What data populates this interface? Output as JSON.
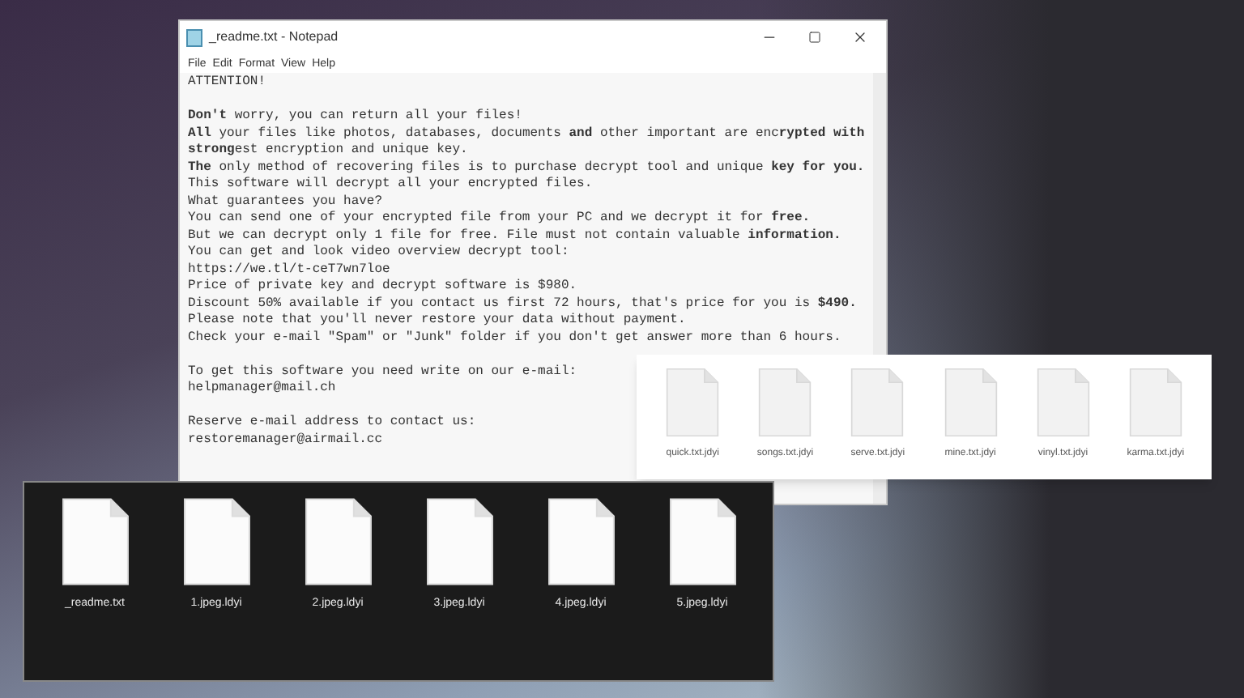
{
  "notepad": {
    "title": "_readme.txt - Notepad",
    "menu": [
      "File",
      "Edit",
      "Format",
      "View",
      "Help"
    ],
    "paragraphs": [
      [
        "ATTENTION!"
      ],
      [
        "**Don't** worry, you can return all your files!",
        "**All** your files like photos, databases, documents **and** other important are enc**rypted with**",
        "**strong**est encryption and unique key.",
        "**The** only method of recovering files is to purchase decrypt tool and unique **key for you.**",
        "This software will decrypt all your encrypted files.",
        "What guarantees you have?",
        "You can send one of your encrypted file from your PC and we decrypt it for **free.**",
        "But we can decrypt only 1 file for free. File must not contain valuable **information.**",
        "You can get and look video overview decrypt tool:",
        "https://we.tl/t-ceT7wn7loe",
        "Price of private key and decrypt software is $980.",
        "Discount 50% available if you contact us first 72 hours, that's price for you is **$490.**",
        "Please note that you'll never restore your data without payment.",
        "Check your e-mail \"Spam\" or \"Junk\" folder if you don't get answer more than 6 hours."
      ],
      [
        "To get this software you need write on our e-mail:",
        "helpmanager@mail.ch"
      ],
      [
        "Reserve e-mail address to contact us:",
        "restoremanager@airmail.cc"
      ]
    ]
  },
  "light_folder": {
    "files": [
      "quick.txt.jdyi",
      "songs.txt.jdyi",
      "serve.txt.jdyi",
      "mine.txt.jdyi",
      "vinyl.txt.jdyi",
      "karma.txt.jdyi"
    ]
  },
  "dark_folder": {
    "files": [
      "_readme.txt",
      "1.jpeg.ldyi",
      "2.jpeg.ldyi",
      "3.jpeg.ldyi",
      "4.jpeg.ldyi",
      "5.jpeg.ldyi"
    ]
  }
}
